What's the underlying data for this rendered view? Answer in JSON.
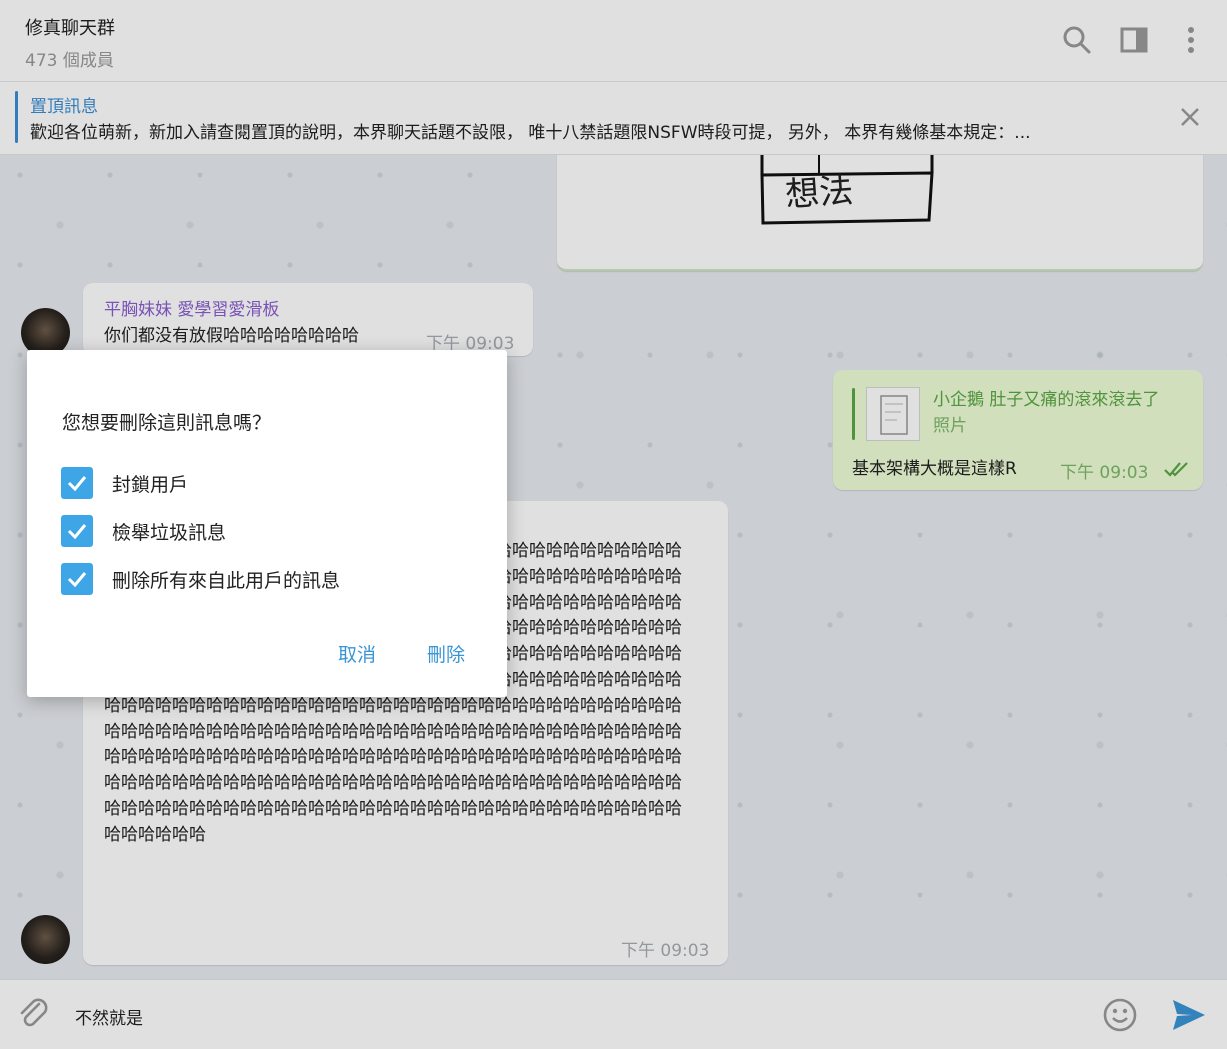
{
  "header": {
    "title": "修真聊天群",
    "subtitle": "473 個成員",
    "icons": [
      "search-icon",
      "sidebar-toggle-icon",
      "more-vert-icon"
    ]
  },
  "pinned": {
    "title": "置頂訊息",
    "text": "歡迎各位萌新，新加入請查閱置頂的說明，本界聊天話題不設限， 唯十八禁話題限NSFW時段可提， 另外， 本界有幾條基本規定：..."
  },
  "messages": {
    "image_note": "想法",
    "msg1": {
      "sender": "平胸妹妹 愛學習愛滑板",
      "text": "你们都没有放假哈哈哈哈哈哈哈哈",
      "time": "下午 09:03"
    },
    "msg2": {
      "reply_author": "小企鵝 肚子又痛的滾來滾去了",
      "reply_type": "照片",
      "text": "基本架構大概是這樣R",
      "time": "下午 09:03"
    },
    "msg3": {
      "text": "哈哈哈哈哈哈哈哈哈哈哈哈哈哈哈哈哈哈哈哈哈哈哈哈哈哈哈哈哈哈哈哈哈哈哈哈哈哈哈哈哈哈哈哈哈哈哈哈哈哈哈哈哈哈哈哈哈哈哈哈哈哈哈哈哈哈哈哈哈哈哈哈哈哈哈哈哈哈哈哈哈哈哈哈哈哈哈哈哈哈哈哈哈哈哈哈哈哈哈哈哈哈哈哈哈哈哈哈哈哈哈哈哈哈哈哈哈哈哈哈哈哈哈哈哈哈哈哈哈哈哈哈哈哈哈哈哈哈哈哈哈哈哈哈哈哈哈哈哈哈哈哈哈哈哈哈哈哈哈哈哈哈哈哈哈哈哈哈哈哈哈哈哈哈哈哈哈哈哈哈哈哈哈哈哈哈哈哈哈哈哈哈哈哈哈哈哈哈哈哈哈哈哈哈哈哈哈哈哈哈哈哈哈哈哈哈哈哈哈哈哈哈哈哈哈哈哈哈哈哈哈哈哈哈哈哈哈哈哈哈哈哈哈哈哈哈哈哈哈哈哈哈哈哈哈哈哈哈哈哈哈哈哈哈哈哈哈哈哈哈哈哈哈哈哈哈哈哈哈哈哈哈哈哈哈哈哈哈哈哈哈哈哈哈哈哈哈哈哈哈哈哈哈哈哈哈哈哈哈哈哈哈哈哈哈哈哈哈哈哈哈哈哈哈哈哈哈哈哈哈哈哈哈哈哈哈哈哈哈哈哈哈哈哈哈哈哈哈哈哈哈哈哈哈哈哈哈哈哈哈哈哈哈哈哈哈哈哈哈哈哈哈哈哈哈哈哈哈哈哈",
      "time": "下午 09:03"
    }
  },
  "input": {
    "value": "不然就是",
    "icons": [
      "attach-icon",
      "emoji-icon",
      "send-icon"
    ]
  },
  "dialog": {
    "question": "您想要刪除這則訊息嗎？",
    "options": [
      {
        "label": "封鎖用戶",
        "checked": true
      },
      {
        "label": "檢舉垃圾訊息",
        "checked": true
      },
      {
        "label": "刪除所有來自此用戶的訊息",
        "checked": true
      }
    ],
    "cancel_label": "取消",
    "delete_label": "刪除"
  },
  "colors": {
    "accent": "#3a95d6",
    "checkbox": "#3ea6e6",
    "sender_name": "#8a5fd0",
    "outgoing_bubble": "#eefed8"
  }
}
